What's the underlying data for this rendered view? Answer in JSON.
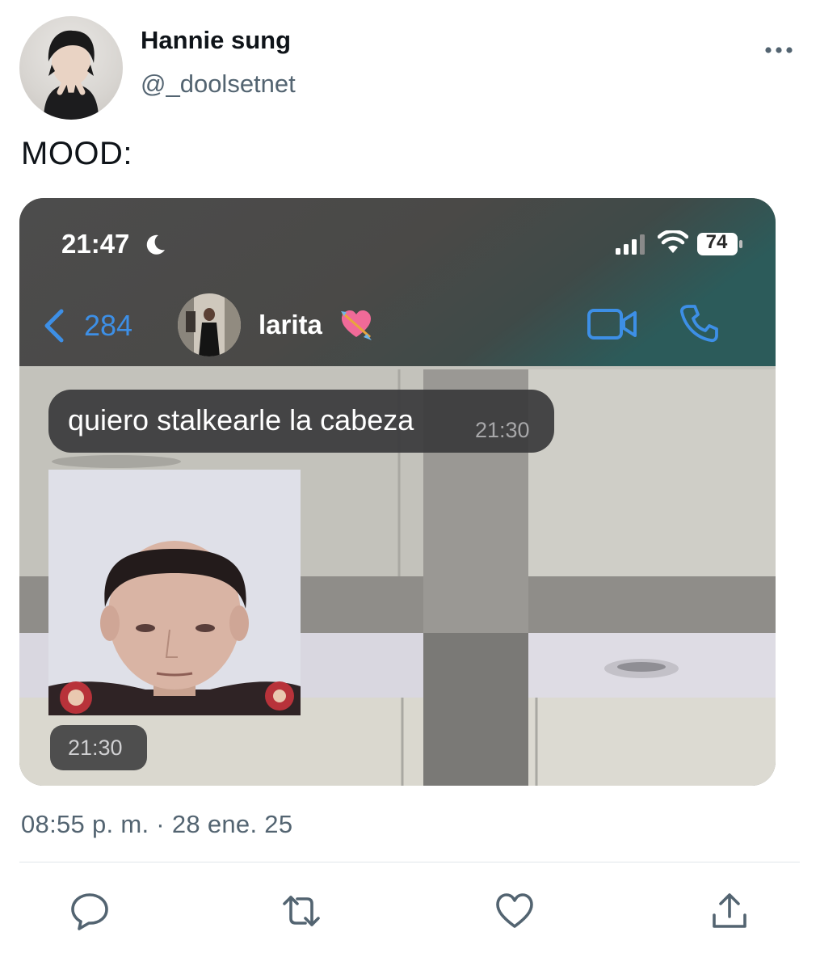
{
  "tweet": {
    "display_name": "Hannie sung",
    "handle": "@_doolsetnet",
    "text": "MOOD:",
    "timestamp": "08:55 p. m. · 28 ene. 25"
  },
  "media": {
    "status_bar": {
      "time": "21:47",
      "battery": "74",
      "icons": [
        "moon-icon",
        "signal-icon",
        "wifi-icon",
        "battery-icon"
      ]
    },
    "chat_header": {
      "back_count": "284",
      "contact_name": "larita",
      "icons": [
        "back-chevron-icon",
        "heart-arrow-emoji",
        "video-call-icon",
        "phone-call-icon"
      ]
    },
    "messages": [
      {
        "type": "text",
        "text": "quiero stalkearle la cabeza",
        "time": "21:30"
      },
      {
        "type": "photo",
        "time": "21:30"
      }
    ]
  },
  "actions": [
    "reply-icon",
    "retweet-icon",
    "like-icon",
    "share-icon"
  ],
  "colors": {
    "ios_blue": "#3d8fe6",
    "secondary_text": "#536471",
    "bubble": "#3a3a3c"
  }
}
